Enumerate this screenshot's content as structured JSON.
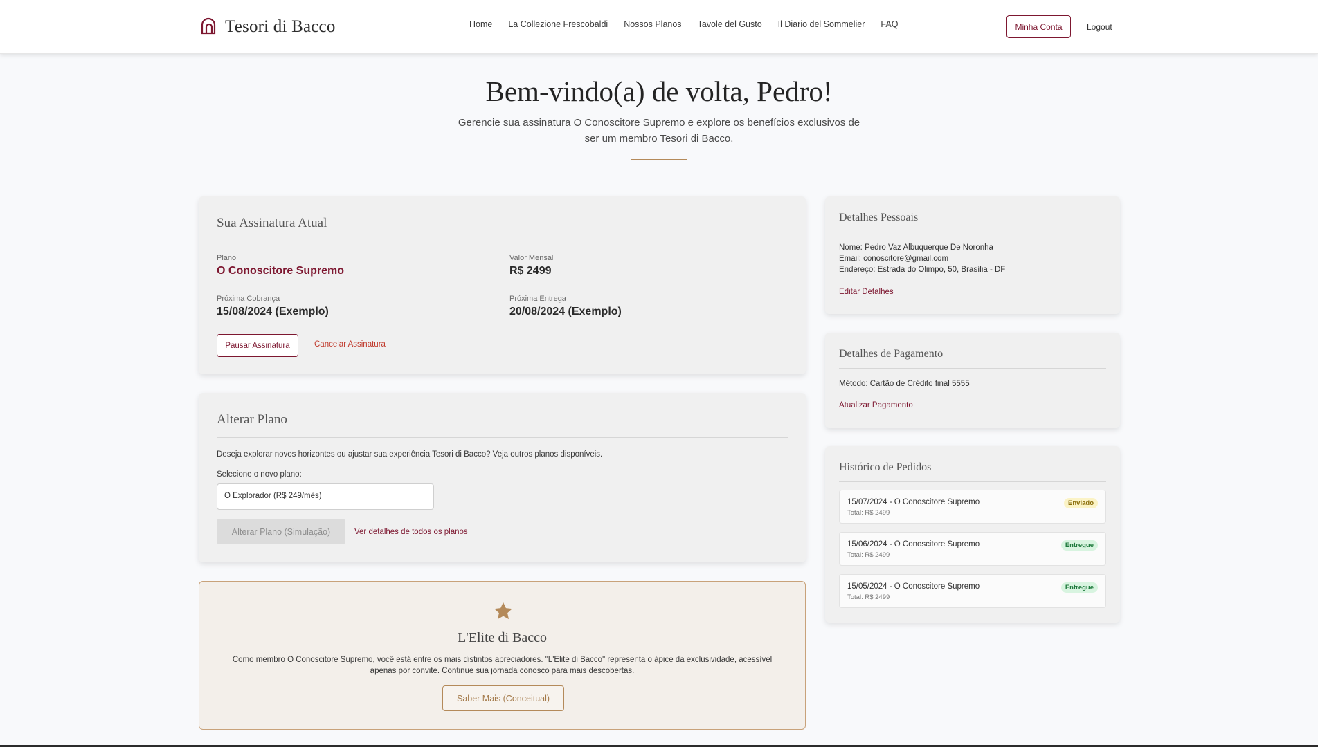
{
  "header": {
    "brand": "Tesori di Bacco",
    "nav": [
      "Home",
      "La Collezione Frescobaldi",
      "Nossos Planos",
      "Tavole del Gusto",
      "Il Diario del Sommelier",
      "FAQ"
    ],
    "account_button": "Minha Conta",
    "logout": "Logout"
  },
  "hero": {
    "title": "Bem-vindo(a) de volta, Pedro!",
    "subtitle": "Gerencie sua assinatura O Conoscitore Supremo e explore os benefícios exclusivos de ser um membro Tesori di Bacco."
  },
  "subscription": {
    "title": "Sua Assinatura Atual",
    "plan_label": "Plano",
    "plan_value": "O Conoscitore Supremo",
    "monthly_label": "Valor Mensal",
    "monthly_value": "R$ 2499",
    "next_billing_label": "Próxima Cobrança",
    "next_billing_value": "15/08/2024 (Exemplo)",
    "next_delivery_label": "Próxima Entrega",
    "next_delivery_value": "20/08/2024 (Exemplo)",
    "pause_button": "Pausar Assinatura",
    "cancel_link": "Cancelar Assinatura"
  },
  "change_plan": {
    "title": "Alterar Plano",
    "description": "Deseja explorar novos horizontes ou ajustar sua experiência Tesori di Bacco? Veja outros planos disponíveis.",
    "select_label": "Selecione o novo plano:",
    "selected_option": "O Explorador (R$ 249/mês)",
    "change_button": "Alterar Plano (Simulação)",
    "details_link": "Ver detalhes de todos os planos"
  },
  "elite": {
    "title": "L'Elite di Bacco",
    "text": "Como membro O Conoscitore Supremo, você está entre os mais distintos apreciadores. \"L'Elite di Bacco\" representa o ápice da exclusividade, acessível apenas por convite. Continue sua jornada conosco para mais descobertas.",
    "button": "Saber Mais (Conceitual)"
  },
  "personal": {
    "title": "Detalhes Pessoais",
    "name": "Nome: Pedro Vaz Albuquerque De Noronha",
    "email": "Email: conoscitore@gmail.com",
    "address": "Endereço: Estrada do Olimpo, 50, Brasília - DF",
    "edit_link": "Editar Detalhes"
  },
  "payment": {
    "title": "Detalhes de Pagamento",
    "method": "Método: Cartão de Crédito final 5555",
    "update_link": "Atualizar Pagamento"
  },
  "history": {
    "title": "Histórico de Pedidos",
    "orders": [
      {
        "title": "15/07/2024 - O Conoscitore Supremo",
        "total": "Total: R$ 2499",
        "status": "Enviado"
      },
      {
        "title": "15/06/2024 - O Conoscitore Supremo",
        "total": "Total: R$ 2499",
        "status": "Entregue"
      },
      {
        "title": "15/05/2024 - O Conoscitore Supremo",
        "total": "Total: R$ 2499",
        "status": "Entregue"
      }
    ]
  },
  "colors": {
    "brand_burgundy": "#7d1730",
    "gold": "#b48a5a",
    "cancel_red": "#c0392b"
  },
  "icons": {
    "logo": "arch-logo-icon",
    "elite": "star-icon"
  }
}
